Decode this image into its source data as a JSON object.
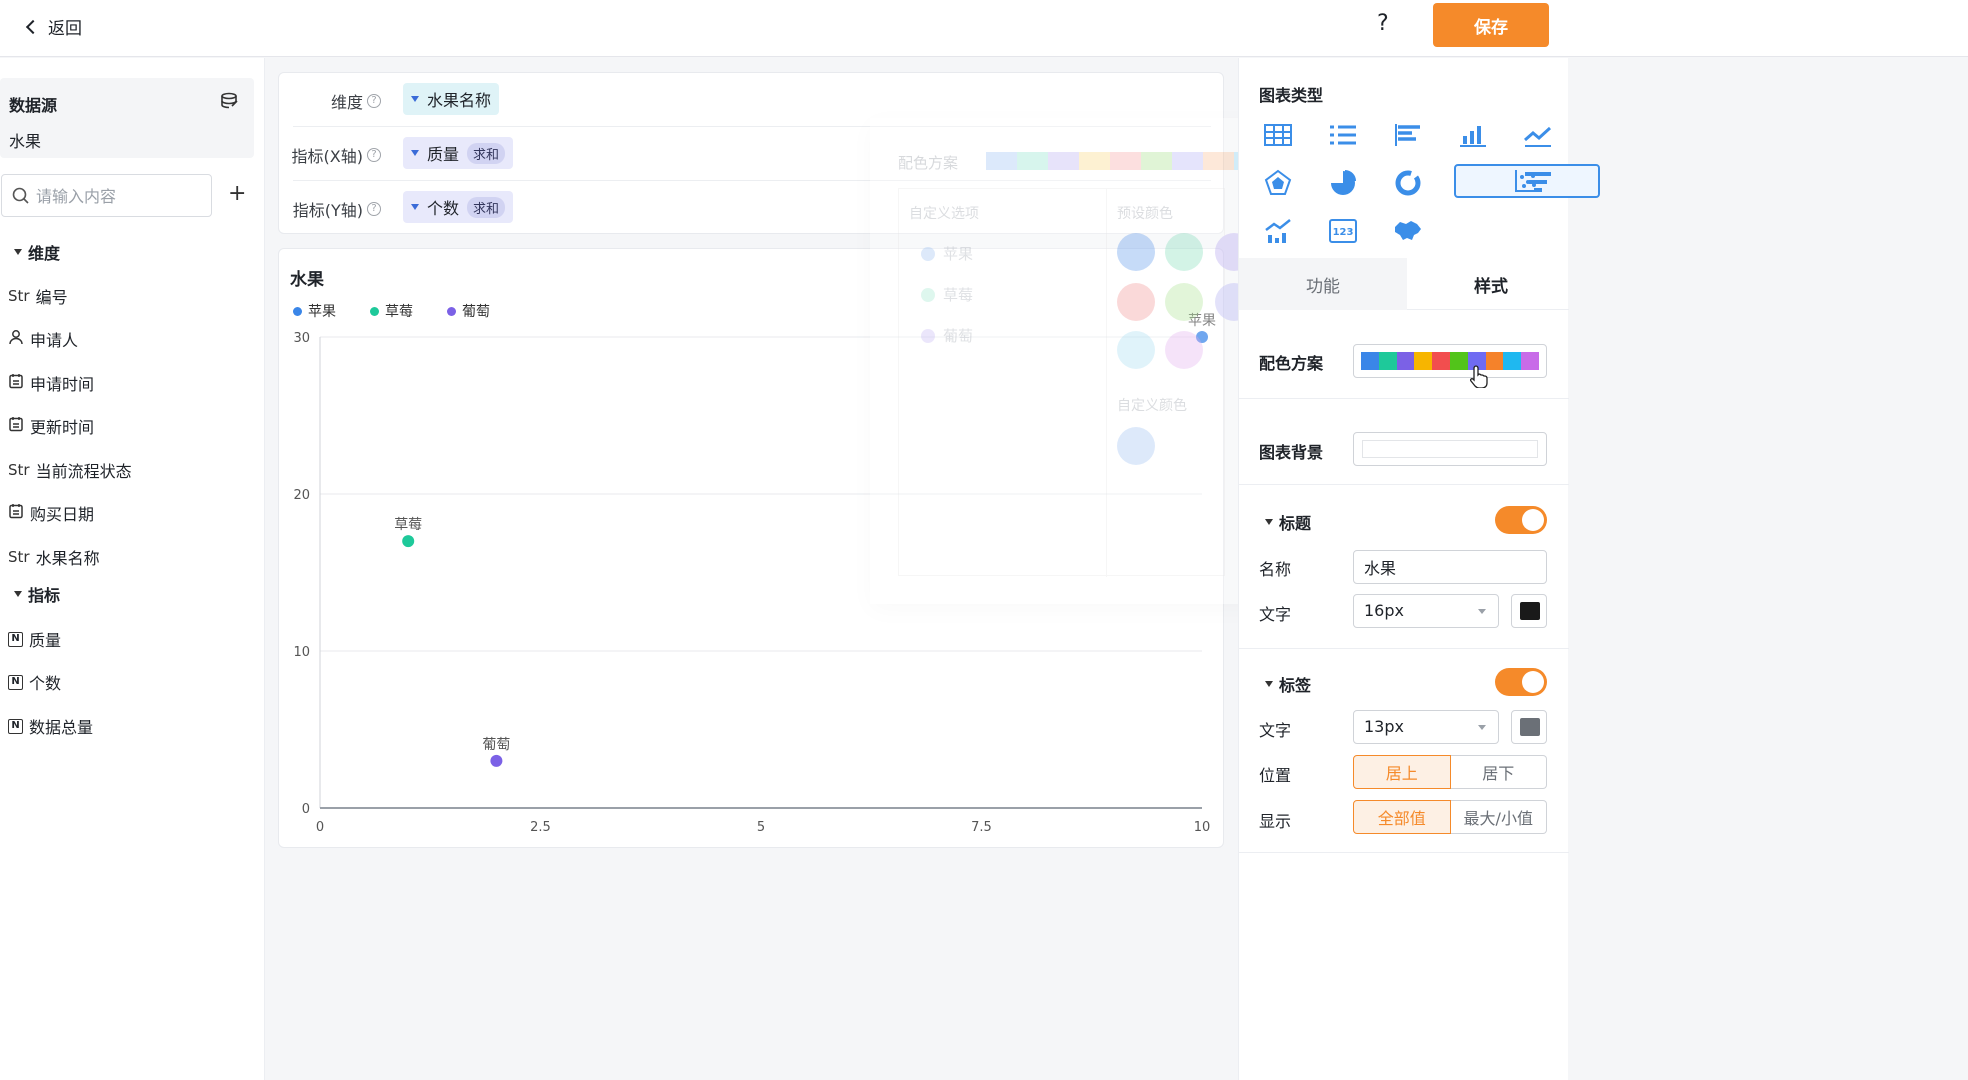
{
  "topbar": {
    "back_label": "返回",
    "help_label": "?",
    "save_label": "保存"
  },
  "left": {
    "datasource_title": "数据源",
    "datasource_name": "水果",
    "search_placeholder": "请输入内容",
    "dimensions_title": "维度",
    "dimension_fields": [
      {
        "type": "Str",
        "name": "编号"
      },
      {
        "type": "user",
        "name": "申请人"
      },
      {
        "type": "date",
        "name": "申请时间"
      },
      {
        "type": "date",
        "name": "更新时间"
      },
      {
        "type": "Str",
        "name": "当前流程状态"
      },
      {
        "type": "date",
        "name": "购买日期"
      },
      {
        "type": "Str",
        "name": "水果名称"
      }
    ],
    "metrics_title": "指标",
    "metric_fields": [
      {
        "type": "N",
        "name": "质量"
      },
      {
        "type": "N",
        "name": "个数"
      },
      {
        "type": "N",
        "name": "数据总量"
      }
    ]
  },
  "config": {
    "dimension_label": "维度",
    "dimension_value": "水果名称",
    "xaxis_label": "指标(X轴)",
    "xaxis_value": "质量",
    "xaxis_agg": "求和",
    "yaxis_label": "指标(Y轴)",
    "yaxis_value": "个数",
    "yaxis_agg": "求和"
  },
  "ghost_panel": {
    "color_scheme": "配色方案",
    "custom_options": "自定义选项",
    "preset_colors": "预设颜色",
    "custom_color": "自定义颜色",
    "options": [
      "苹果",
      "草莓",
      "葡萄"
    ]
  },
  "chart_data": {
    "type": "scatter",
    "title": "水果",
    "xlabel": "",
    "ylabel": "",
    "xlim": [
      0,
      10
    ],
    "ylim": [
      0,
      30
    ],
    "xticks": [
      "0",
      "2.5",
      "5",
      "7.5",
      "10"
    ],
    "yticks": [
      "0",
      "10",
      "20",
      "30"
    ],
    "grid": true,
    "legend_position": "top-left",
    "series": [
      {
        "name": "苹果",
        "color": "#3a86e8",
        "points": [
          {
            "x": 10,
            "y": 30
          }
        ]
      },
      {
        "name": "草莓",
        "color": "#1ec99a",
        "points": [
          {
            "x": 1,
            "y": 17
          }
        ]
      },
      {
        "name": "葡萄",
        "color": "#7b61e6",
        "points": [
          {
            "x": 2,
            "y": 3
          }
        ]
      }
    ]
  },
  "right": {
    "chart_type_title": "图表类型",
    "chart_types": [
      "table-icon",
      "list-icon",
      "horizontal-bar-icon",
      "bar-chart-icon",
      "line-chart-icon",
      "radar-icon",
      "pie-icon",
      "donut-icon",
      "scatter-icon",
      "funnel-icon",
      "combo-chart-icon",
      "number-card-icon",
      "map-icon"
    ],
    "selected_chart_type": "scatter-icon",
    "tab_function": "功能",
    "tab_style": "样式",
    "color_scheme_label": "配色方案",
    "palette": [
      "#3a86e8",
      "#1ec99a",
      "#7b61e6",
      "#f7b500",
      "#f24e4e",
      "#52c41a",
      "#6f6bf2",
      "#f5822a",
      "#1fb8f0",
      "#c86be8"
    ],
    "chart_bg_label": "图表背景",
    "title_group": "标题",
    "title_name_label": "名称",
    "title_name_value": "水果",
    "title_font_label": "文字",
    "title_font_size": "16px",
    "title_font_color": "#1a1a1a",
    "label_group": "标签",
    "label_font_label": "文字",
    "label_font_size": "13px",
    "label_font_color": "#6b7077",
    "position_label": "位置",
    "position_options": [
      "居上",
      "居下"
    ],
    "display_label": "显示",
    "display_options": [
      "全部值",
      "最大/小值"
    ]
  }
}
